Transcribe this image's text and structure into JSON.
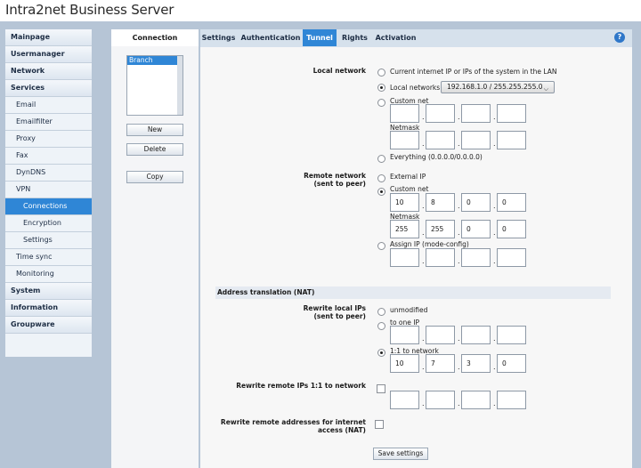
{
  "app": {
    "brand_bold": "Intra2net",
    "brand_rest": "Business Server"
  },
  "sidebar": {
    "items": [
      {
        "label": "Mainpage",
        "level": 0
      },
      {
        "label": "Usermanager",
        "level": 0
      },
      {
        "label": "Network",
        "level": 0
      },
      {
        "label": "Services",
        "level": 0
      },
      {
        "label": "Email",
        "level": 1
      },
      {
        "label": "Emailfilter",
        "level": 1
      },
      {
        "label": "Proxy",
        "level": 1
      },
      {
        "label": "Fax",
        "level": 1
      },
      {
        "label": "DynDNS",
        "level": 1
      },
      {
        "label": "VPN",
        "level": 1
      },
      {
        "label": "Connections",
        "level": 2,
        "active": true
      },
      {
        "label": "Encryption",
        "level": 2
      },
      {
        "label": "Settings",
        "level": 2
      },
      {
        "label": "Time sync",
        "level": 1
      },
      {
        "label": "Monitoring",
        "level": 1
      },
      {
        "label": "System",
        "level": 0
      },
      {
        "label": "Information",
        "level": 0
      },
      {
        "label": "Groupware",
        "level": 0
      }
    ]
  },
  "list": {
    "tab_label": "Connection",
    "items": [
      "Branch"
    ],
    "new_label": "New",
    "delete_label": "Delete",
    "copy_label": "Copy"
  },
  "tabs": [
    "Settings",
    "Authentication",
    "Tunnel",
    "Rights",
    "Activation"
  ],
  "active_tab": "Tunnel",
  "help_label": "?",
  "local_network": {
    "label": "Local network",
    "opt_current": "Current internet IP or IPs of the system in the LAN",
    "opt_local": "Local networks",
    "local_value": "192.168.1.0 / 255.255.255.0",
    "opt_custom": "Custom net",
    "netmask_label": "Netmask",
    "opt_everything": "Everything (0.0.0.0/0.0.0.0)"
  },
  "remote_network": {
    "label_line1": "Remote network",
    "label_line2": "(sent to peer)",
    "opt_external": "External IP",
    "opt_custom": "Custom net",
    "custom_ip": [
      "10",
      "8",
      "0",
      "0"
    ],
    "netmask_label": "Netmask",
    "netmask": [
      "255",
      "255",
      "0",
      "0"
    ],
    "opt_assign": "Assign IP (mode-config)"
  },
  "nat": {
    "section_title": "Address translation (NAT)",
    "rewrite_local_line1": "Rewrite local IPs",
    "rewrite_local_line2": "(sent to peer)",
    "opt_unmodified": "unmodified",
    "opt_to_one": "to one IP",
    "opt_one_to_one": "1:1 to network",
    "one_to_one_ip": [
      "10",
      "7",
      "3",
      "0"
    ],
    "rewrite_remote": "Rewrite remote IPs 1:1 to network",
    "rewrite_internet_line1": "Rewrite remote addresses for internet",
    "rewrite_internet_line2": "access (NAT)"
  },
  "save_label": "Save settings",
  "colors": {
    "accent": "#2f86d6",
    "background": "#b6c5d6"
  }
}
